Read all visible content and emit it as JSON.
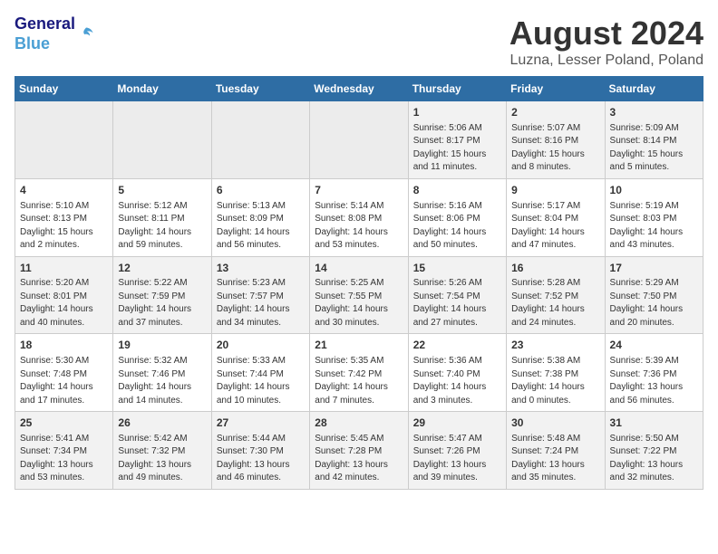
{
  "header": {
    "logo_line1": "General",
    "logo_line2": "Blue",
    "month_year": "August 2024",
    "location": "Luzna, Lesser Poland, Poland"
  },
  "weekdays": [
    "Sunday",
    "Monday",
    "Tuesday",
    "Wednesday",
    "Thursday",
    "Friday",
    "Saturday"
  ],
  "weeks": [
    [
      {
        "day": "",
        "info": ""
      },
      {
        "day": "",
        "info": ""
      },
      {
        "day": "",
        "info": ""
      },
      {
        "day": "",
        "info": ""
      },
      {
        "day": "1",
        "info": "Sunrise: 5:06 AM\nSunset: 8:17 PM\nDaylight: 15 hours\nand 11 minutes."
      },
      {
        "day": "2",
        "info": "Sunrise: 5:07 AM\nSunset: 8:16 PM\nDaylight: 15 hours\nand 8 minutes."
      },
      {
        "day": "3",
        "info": "Sunrise: 5:09 AM\nSunset: 8:14 PM\nDaylight: 15 hours\nand 5 minutes."
      }
    ],
    [
      {
        "day": "4",
        "info": "Sunrise: 5:10 AM\nSunset: 8:13 PM\nDaylight: 15 hours\nand 2 minutes."
      },
      {
        "day": "5",
        "info": "Sunrise: 5:12 AM\nSunset: 8:11 PM\nDaylight: 14 hours\nand 59 minutes."
      },
      {
        "day": "6",
        "info": "Sunrise: 5:13 AM\nSunset: 8:09 PM\nDaylight: 14 hours\nand 56 minutes."
      },
      {
        "day": "7",
        "info": "Sunrise: 5:14 AM\nSunset: 8:08 PM\nDaylight: 14 hours\nand 53 minutes."
      },
      {
        "day": "8",
        "info": "Sunrise: 5:16 AM\nSunset: 8:06 PM\nDaylight: 14 hours\nand 50 minutes."
      },
      {
        "day": "9",
        "info": "Sunrise: 5:17 AM\nSunset: 8:04 PM\nDaylight: 14 hours\nand 47 minutes."
      },
      {
        "day": "10",
        "info": "Sunrise: 5:19 AM\nSunset: 8:03 PM\nDaylight: 14 hours\nand 43 minutes."
      }
    ],
    [
      {
        "day": "11",
        "info": "Sunrise: 5:20 AM\nSunset: 8:01 PM\nDaylight: 14 hours\nand 40 minutes."
      },
      {
        "day": "12",
        "info": "Sunrise: 5:22 AM\nSunset: 7:59 PM\nDaylight: 14 hours\nand 37 minutes."
      },
      {
        "day": "13",
        "info": "Sunrise: 5:23 AM\nSunset: 7:57 PM\nDaylight: 14 hours\nand 34 minutes."
      },
      {
        "day": "14",
        "info": "Sunrise: 5:25 AM\nSunset: 7:55 PM\nDaylight: 14 hours\nand 30 minutes."
      },
      {
        "day": "15",
        "info": "Sunrise: 5:26 AM\nSunset: 7:54 PM\nDaylight: 14 hours\nand 27 minutes."
      },
      {
        "day": "16",
        "info": "Sunrise: 5:28 AM\nSunset: 7:52 PM\nDaylight: 14 hours\nand 24 minutes."
      },
      {
        "day": "17",
        "info": "Sunrise: 5:29 AM\nSunset: 7:50 PM\nDaylight: 14 hours\nand 20 minutes."
      }
    ],
    [
      {
        "day": "18",
        "info": "Sunrise: 5:30 AM\nSunset: 7:48 PM\nDaylight: 14 hours\nand 17 minutes."
      },
      {
        "day": "19",
        "info": "Sunrise: 5:32 AM\nSunset: 7:46 PM\nDaylight: 14 hours\nand 14 minutes."
      },
      {
        "day": "20",
        "info": "Sunrise: 5:33 AM\nSunset: 7:44 PM\nDaylight: 14 hours\nand 10 minutes."
      },
      {
        "day": "21",
        "info": "Sunrise: 5:35 AM\nSunset: 7:42 PM\nDaylight: 14 hours\nand 7 minutes."
      },
      {
        "day": "22",
        "info": "Sunrise: 5:36 AM\nSunset: 7:40 PM\nDaylight: 14 hours\nand 3 minutes."
      },
      {
        "day": "23",
        "info": "Sunrise: 5:38 AM\nSunset: 7:38 PM\nDaylight: 14 hours\nand 0 minutes."
      },
      {
        "day": "24",
        "info": "Sunrise: 5:39 AM\nSunset: 7:36 PM\nDaylight: 13 hours\nand 56 minutes."
      }
    ],
    [
      {
        "day": "25",
        "info": "Sunrise: 5:41 AM\nSunset: 7:34 PM\nDaylight: 13 hours\nand 53 minutes."
      },
      {
        "day": "26",
        "info": "Sunrise: 5:42 AM\nSunset: 7:32 PM\nDaylight: 13 hours\nand 49 minutes."
      },
      {
        "day": "27",
        "info": "Sunrise: 5:44 AM\nSunset: 7:30 PM\nDaylight: 13 hours\nand 46 minutes."
      },
      {
        "day": "28",
        "info": "Sunrise: 5:45 AM\nSunset: 7:28 PM\nDaylight: 13 hours\nand 42 minutes."
      },
      {
        "day": "29",
        "info": "Sunrise: 5:47 AM\nSunset: 7:26 PM\nDaylight: 13 hours\nand 39 minutes."
      },
      {
        "day": "30",
        "info": "Sunrise: 5:48 AM\nSunset: 7:24 PM\nDaylight: 13 hours\nand 35 minutes."
      },
      {
        "day": "31",
        "info": "Sunrise: 5:50 AM\nSunset: 7:22 PM\nDaylight: 13 hours\nand 32 minutes."
      }
    ]
  ]
}
